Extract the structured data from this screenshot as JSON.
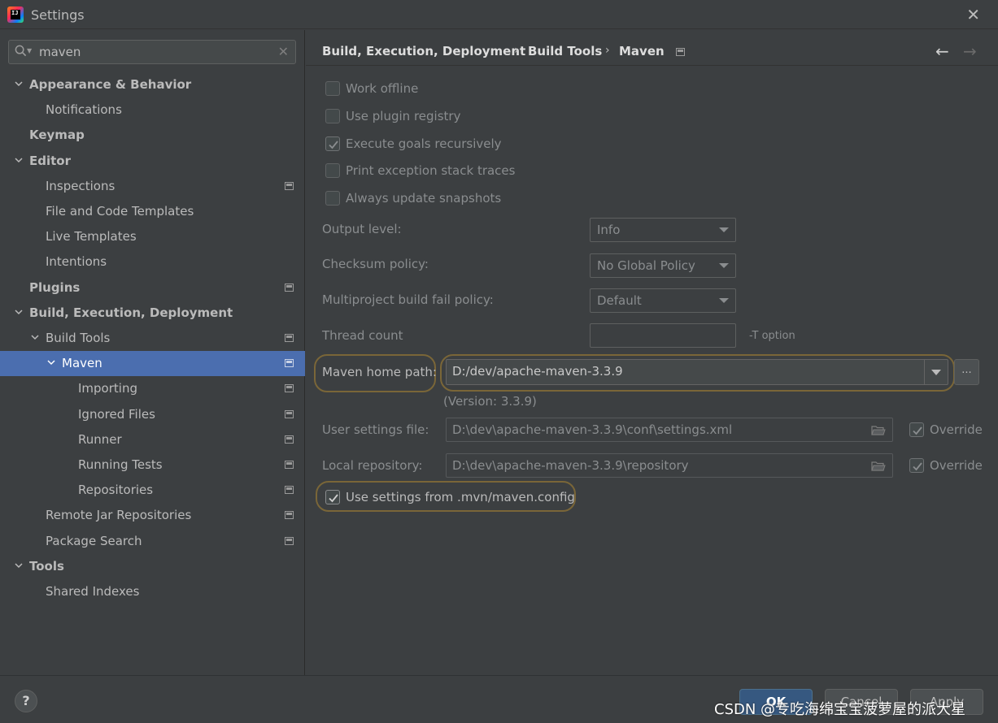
{
  "window": {
    "title": "Settings"
  },
  "search": {
    "value": "maven"
  },
  "tree": [
    {
      "label": "Appearance & Behavior",
      "bold": true,
      "arrow": "down",
      "level": 0
    },
    {
      "label": "Notifications",
      "bold": false,
      "arrow": "none",
      "level": 1
    },
    {
      "label": "Keymap",
      "bold": true,
      "arrow": "none",
      "level": 0
    },
    {
      "label": "Editor",
      "bold": true,
      "arrow": "down",
      "level": 0
    },
    {
      "label": "Inspections",
      "bold": false,
      "arrow": "none",
      "level": 1,
      "project_icon": true
    },
    {
      "label": "File and Code Templates",
      "bold": false,
      "arrow": "none",
      "level": 1
    },
    {
      "label": "Live Templates",
      "bold": false,
      "arrow": "none",
      "level": 1
    },
    {
      "label": "Intentions",
      "bold": false,
      "arrow": "none",
      "level": 1
    },
    {
      "label": "Plugins",
      "bold": true,
      "arrow": "none",
      "level": 0,
      "project_icon": true
    },
    {
      "label": "Build, Execution, Deployment",
      "bold": true,
      "arrow": "down",
      "level": 0
    },
    {
      "label": "Build Tools",
      "bold": false,
      "arrow": "down",
      "level": 1,
      "project_icon": true
    },
    {
      "label": "Maven",
      "bold": false,
      "arrow": "down",
      "level": 2,
      "project_icon": true,
      "selected": true
    },
    {
      "label": "Importing",
      "bold": false,
      "arrow": "none",
      "level": 3,
      "project_icon": true
    },
    {
      "label": "Ignored Files",
      "bold": false,
      "arrow": "none",
      "level": 3,
      "project_icon": true
    },
    {
      "label": "Runner",
      "bold": false,
      "arrow": "none",
      "level": 3,
      "project_icon": true
    },
    {
      "label": "Running Tests",
      "bold": false,
      "arrow": "none",
      "level": 3,
      "project_icon": true
    },
    {
      "label": "Repositories",
      "bold": false,
      "arrow": "none",
      "level": 3,
      "project_icon": true
    },
    {
      "label": "Remote Jar Repositories",
      "bold": false,
      "arrow": "none",
      "level": 1,
      "project_icon": true
    },
    {
      "label": "Package Search",
      "bold": false,
      "arrow": "none",
      "level": 1,
      "project_icon": true
    },
    {
      "label": "Tools",
      "bold": true,
      "arrow": "down",
      "level": 0
    },
    {
      "label": "Shared Indexes",
      "bold": false,
      "arrow": "none",
      "level": 1
    }
  ],
  "breadcrumb": [
    "Build, Execution, Deployment",
    "Build Tools",
    "Maven"
  ],
  "checkboxes": {
    "work_offline": {
      "label": "Work offline",
      "checked": false
    },
    "use_plugin_registry": {
      "label": "Use plugin registry",
      "checked": false
    },
    "execute_goals_recursively": {
      "label": "Execute goals recursively",
      "checked": true
    },
    "print_exception_stack_traces": {
      "label": "Print exception stack traces",
      "checked": false
    },
    "always_update_snapshots": {
      "label": "Always update snapshots",
      "checked": false
    }
  },
  "fields": {
    "output_level": {
      "label": "Output level:",
      "value": "Info"
    },
    "checksum_policy": {
      "label": "Checksum policy:",
      "value": "No Global Policy"
    },
    "multiproject_fail_policy": {
      "label": "Multiproject build fail policy:",
      "value": "Default"
    },
    "thread_count": {
      "label": "Thread count",
      "value": "",
      "hint": "-T option"
    },
    "maven_home": {
      "label": "Maven home path:",
      "value": "D:/dev/apache-maven-3.3.9",
      "version": "(Version: 3.3.9)",
      "browse": "..."
    },
    "user_settings": {
      "label": "User settings file:",
      "value": "D:\\dev\\apache-maven-3.3.9\\conf\\settings.xml",
      "override_label": "Override",
      "override": true
    },
    "local_repository": {
      "label": "Local repository:",
      "value": "D:\\dev\\apache-maven-3.3.9\\repository",
      "override_label": "Override",
      "override": true
    },
    "use_mvn_config": {
      "label": "Use settings from .mvn/maven.config",
      "checked": true
    }
  },
  "footer": {
    "help": "?",
    "ok": "OK",
    "cancel": "Cancel",
    "apply": "Apply",
    "watermark": "CSDN @专吃海绵宝宝菠萝屋的派大星"
  },
  "colors": {
    "selection": "#4b6eaf",
    "highlight_outline": "#7a6638",
    "ok_button": "#365880"
  }
}
